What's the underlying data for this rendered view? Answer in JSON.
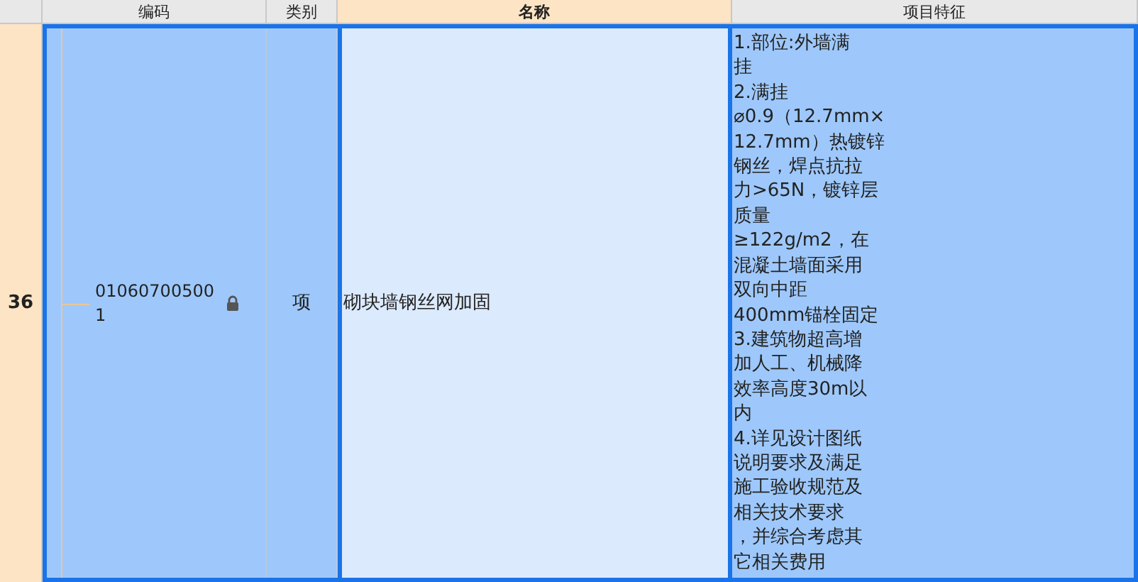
{
  "table": {
    "columns": [
      {
        "label": "编码",
        "selected": false
      },
      {
        "label": "类别",
        "selected": false
      },
      {
        "label": "名称",
        "selected": true
      },
      {
        "label": "项目特征",
        "selected": false
      }
    ],
    "rows": [
      {
        "number": "36",
        "selected": true,
        "code": "010607005001",
        "locked": true,
        "type": "项",
        "name": "砌块墙钢丝网加固",
        "name_selected": true,
        "features": [
          "1.部位:外墙满",
          "挂",
          "2.满挂",
          "⌀0.9（12.7mm×",
          "12.7mm）热镀锌",
          "钢丝，焊点抗拉",
          "力>65N，镀锌层",
          "质量",
          "≥122g/m2，在",
          "混凝土墙面采用",
          "双向中距",
          "400mm锚栓固定",
          "3.建筑物超高增",
          "加人工、机械降",
          "效率高度30m以",
          "内",
          "4.详见设计图纸",
          "说明要求及满足",
          "施工验收规范及",
          "相关技术要求",
          "，并综合考虑其",
          "它相关费用"
        ]
      }
    ]
  }
}
